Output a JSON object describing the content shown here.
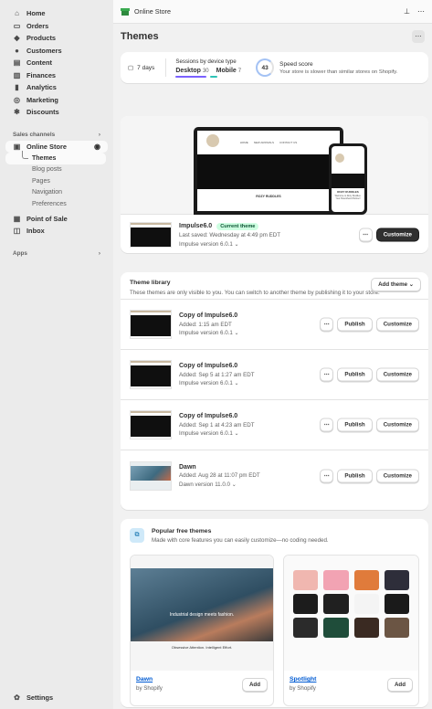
{
  "sidebar": {
    "nav": [
      {
        "label": "Home",
        "icon": "home-icon",
        "glyph": "⌂"
      },
      {
        "label": "Orders",
        "icon": "orders-icon",
        "glyph": "▭"
      },
      {
        "label": "Products",
        "icon": "tag-icon",
        "glyph": "◆"
      },
      {
        "label": "Customers",
        "icon": "person-icon",
        "glyph": "●"
      },
      {
        "label": "Content",
        "icon": "content-icon",
        "glyph": "▤"
      },
      {
        "label": "Finances",
        "icon": "bank-icon",
        "glyph": "▥"
      },
      {
        "label": "Analytics",
        "icon": "chart-icon",
        "glyph": "▮"
      },
      {
        "label": "Marketing",
        "icon": "target-icon",
        "glyph": "◎"
      },
      {
        "label": "Discounts",
        "icon": "discount-icon",
        "glyph": "✱"
      }
    ],
    "sales_channels_label": "Sales channels",
    "online_store": {
      "label": "Online Store"
    },
    "sub_items": [
      "Themes",
      "Blog posts",
      "Pages",
      "Navigation",
      "Preferences"
    ],
    "point_of_sale": "Point of Sale",
    "inbox": "Inbox",
    "apps_label": "Apps",
    "settings": "Settings"
  },
  "topbar": {
    "title": "Online Store"
  },
  "page": {
    "title": "Themes"
  },
  "sessions": {
    "date": "7 days",
    "label": "Sessions by device type",
    "desktop_label": "Desktop",
    "desktop_value": "30",
    "mobile_label": "Mobile",
    "mobile_value": "7",
    "desktop_color": "#7b61ff",
    "mobile_color": "#2ec4b6"
  },
  "speed": {
    "score": "43",
    "title": "Speed score",
    "desc": "Your store is slower than similar stores on Shopify."
  },
  "current_theme": {
    "preview_nav": [
      "HOME",
      "NEW ARRIVALS",
      "CONTACT US"
    ],
    "preview_caption": "ROZY RUDDLES",
    "phone_caption": "ROZY RUDDLES",
    "phone_text": "Welcome to Rozy Ruddles. Your Parenthood Partner!",
    "name": "Impulse6.0",
    "badge": "Current theme",
    "saved": "Last saved: Wednesday at 4:49 pm EDT",
    "version": "Impulse version 6.0.1",
    "customize": "Customize"
  },
  "library": {
    "title": "Theme library",
    "desc": "These themes are only visible to you. You can switch to another theme by publishing it to your store.",
    "add_theme": "Add theme",
    "publish": "Publish",
    "customize": "Customize",
    "items": [
      {
        "name": "Copy of Impulse6.0",
        "added": "Added: 1:15 am EDT",
        "version": "Impulse version 6.0.1"
      },
      {
        "name": "Copy of Impulse6.0",
        "added": "Added: Sep 5 at 1:27 am EDT",
        "version": "Impulse version 6.0.1"
      },
      {
        "name": "Copy of Impulse6.0",
        "added": "Added: Sep 1 at 4:23 am EDT",
        "version": "Impulse version 6.0.1"
      },
      {
        "name": "Dawn",
        "added": "Added: Aug 28 at 11:07 pm EDT",
        "version": "Dawn version 11.0.0"
      }
    ]
  },
  "popular": {
    "title": "Popular free themes",
    "desc": "Made with core features you can easily customize—no coding needed.",
    "add": "Add",
    "dawn_caption": "Industrial design meets fashion.",
    "dawn_caption2": "Obsessive Attention. Intelligent Effort.",
    "themes": [
      {
        "name": "Dawn",
        "by": "by Shopify"
      },
      {
        "name": "Spotlight",
        "by": "by Shopify"
      }
    ],
    "swatches": [
      "#f0b7b0",
      "#f2a3b3",
      "#e07b3b",
      "#2e2e3a",
      "#1c1c1c",
      "#202020",
      "#f4f4f4",
      "#1a1a1a",
      "#2b2b2b",
      "#1f4d3a",
      "#3a2a22",
      "#6b5544"
    ]
  }
}
